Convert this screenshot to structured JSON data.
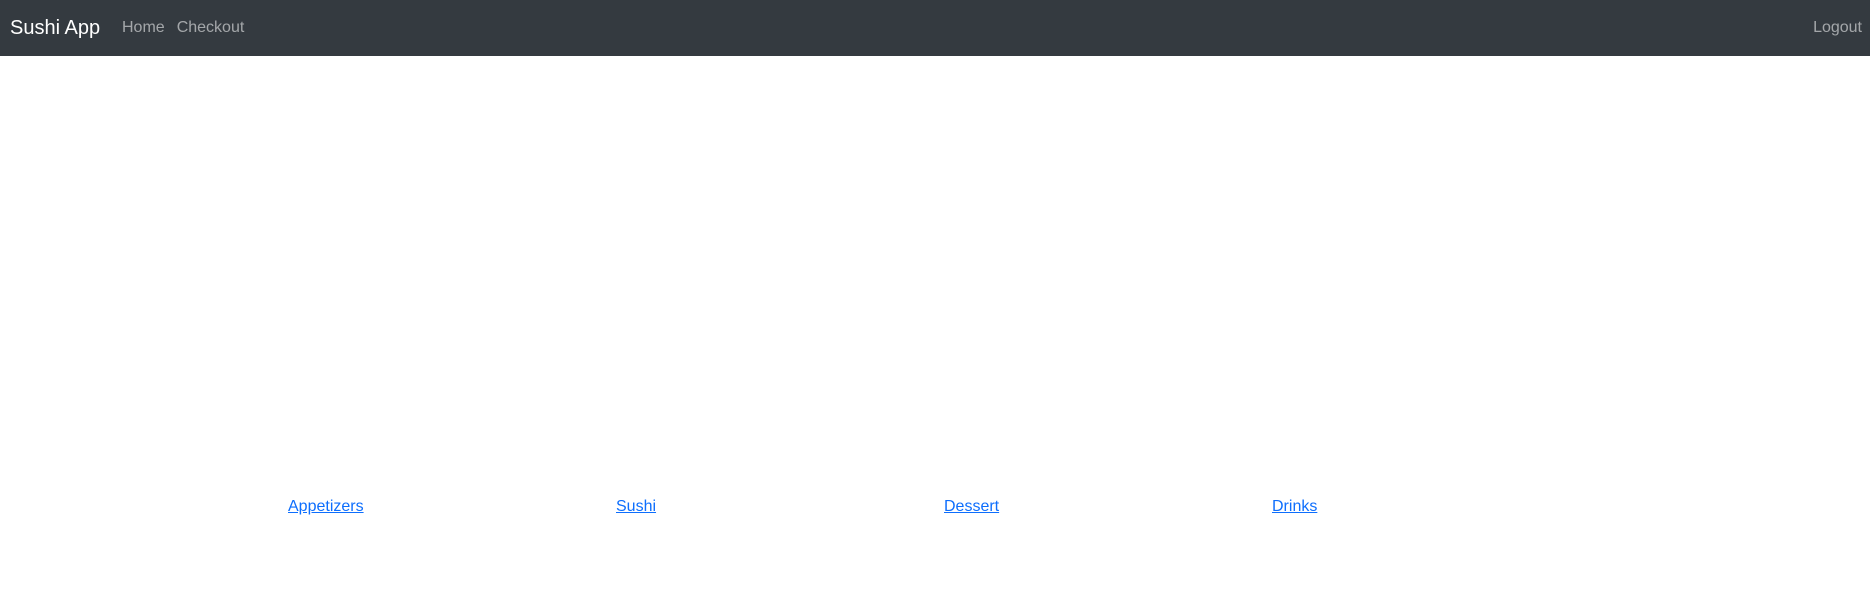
{
  "navbar": {
    "brand": "Sushi App",
    "links": [
      {
        "label": "Home"
      },
      {
        "label": "Checkout"
      }
    ],
    "logout_label": "Logout"
  },
  "categories": [
    {
      "label": "Appetizers"
    },
    {
      "label": "Sushi"
    },
    {
      "label": "Dessert"
    },
    {
      "label": "Drinks"
    }
  ],
  "colors": {
    "navbar_bg": "#343a40",
    "link_accent": "#0d6efd"
  }
}
